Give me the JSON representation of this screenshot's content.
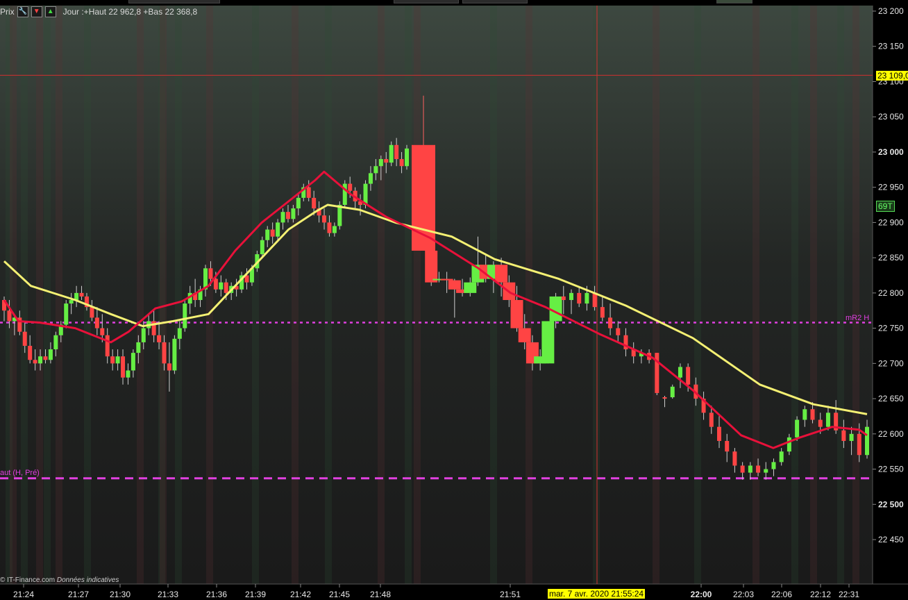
{
  "header": {
    "prefix_label": "Prix",
    "wrench_icon": "wrench-icon",
    "down_icon": "arrow-down-icon",
    "up_icon": "arrow-up-icon",
    "info": "Jour :+Haut 22 962,8 +Bas 22 368,8"
  },
  "credit": {
    "source": "© IT-Finance.com",
    "note": "Données indicatives"
  },
  "tags": {
    "cursor_price": "23 109,0",
    "count_badge": "69T",
    "cursor_datetime": "mar. 7 avr. 2020 21:55:24"
  },
  "levels": {
    "mr2_label": "mR2 H",
    "haut_label": "aut (H, Pré)"
  },
  "colors": {
    "bull": "#66ee44",
    "bear": "#ff4444",
    "ma_fast": "#e8113a",
    "ma_slow": "#f4f073",
    "level_line": "#e040e0",
    "cursor_line": "#d03030",
    "axis_text": "#e8e8e8",
    "tag_yellow": "#ffff00",
    "badge_green": "#55dd55"
  },
  "chart_data": {
    "type": "candlestick",
    "instrument_note": "Intraday tick candles",
    "yaxis": {
      "ticks": [
        23200,
        23150,
        23100,
        23050,
        23000,
        22950,
        22900,
        22850,
        22800,
        22750,
        22700,
        22650,
        22600,
        22550,
        22500,
        22450
      ],
      "tick_labels": [
        "23 200",
        "23 150",
        "23 100",
        "23 050",
        "23 000",
        "22 950",
        "22 900",
        "22 850",
        "22 800",
        "22 750",
        "22 700",
        "22 650",
        "22 600",
        "22 550",
        "22 500",
        "22 450"
      ],
      "bold_labels": [
        "23 000",
        "22 500"
      ],
      "range": [
        22440,
        23210
      ]
    },
    "xaxis": {
      "tick_labels": [
        "21:24",
        "21:27",
        "21:30",
        "21:33",
        "21:36",
        "21:39",
        "21:42",
        "21:45",
        "21:48",
        "21:51",
        "22:00",
        "22:03",
        "22:06",
        "22:12",
        "22:31"
      ],
      "bold_labels": [
        "22:00"
      ]
    },
    "reference_levels": [
      {
        "name": "mR2 H",
        "value": 22758,
        "style": "dotted"
      },
      {
        "name": "Haut (H, Pré)",
        "value": 22537,
        "style": "dashed"
      }
    ],
    "cursor": {
      "price": 23109.0,
      "datetime": "mar. 7 avr. 2020 21:55:24"
    },
    "series": [
      {
        "name": "candles",
        "ohlc": [
          [
            22790,
            22795,
            22760,
            22775
          ],
          [
            22775,
            22790,
            22750,
            22760
          ],
          [
            22760,
            22770,
            22740,
            22765
          ],
          [
            22765,
            22775,
            22740,
            22745
          ],
          [
            22745,
            22760,
            22715,
            22725
          ],
          [
            22725,
            22740,
            22700,
            22705
          ],
          [
            22705,
            22720,
            22690,
            22700
          ],
          [
            22700,
            22720,
            22690,
            22710
          ],
          [
            22710,
            22720,
            22700,
            22705
          ],
          [
            22705,
            22730,
            22700,
            22720
          ],
          [
            22720,
            22745,
            22710,
            22740
          ],
          [
            22740,
            22760,
            22730,
            22755
          ],
          [
            22755,
            22790,
            22750,
            22785
          ],
          [
            22785,
            22800,
            22770,
            22790
          ],
          [
            22790,
            22810,
            22780,
            22800
          ],
          [
            22800,
            22810,
            22790,
            22795
          ],
          [
            22795,
            22800,
            22775,
            22780
          ],
          [
            22780,
            22790,
            22760,
            22765
          ],
          [
            22765,
            22780,
            22740,
            22750
          ],
          [
            22750,
            22770,
            22730,
            22740
          ],
          [
            22740,
            22750,
            22700,
            22710
          ],
          [
            22710,
            22720,
            22690,
            22700
          ],
          [
            22700,
            22720,
            22690,
            22710
          ],
          [
            22710,
            22720,
            22670,
            22680
          ],
          [
            22680,
            22700,
            22670,
            22690
          ],
          [
            22690,
            22720,
            22680,
            22715
          ],
          [
            22715,
            22740,
            22700,
            22730
          ],
          [
            22730,
            22760,
            22720,
            22750
          ],
          [
            22750,
            22770,
            22740,
            22760
          ],
          [
            22760,
            22775,
            22730,
            22740
          ],
          [
            22740,
            22760,
            22720,
            22730
          ],
          [
            22730,
            22740,
            22690,
            22700
          ],
          [
            22700,
            22730,
            22660,
            22690
          ],
          [
            22690,
            22740,
            22685,
            22735
          ],
          [
            22735,
            22760,
            22720,
            22750
          ],
          [
            22750,
            22790,
            22745,
            22785
          ],
          [
            22785,
            22810,
            22770,
            22800
          ],
          [
            22800,
            22820,
            22780,
            22790
          ],
          [
            22790,
            22810,
            22780,
            22805
          ],
          [
            22805,
            22840,
            22795,
            22835
          ],
          [
            22835,
            22845,
            22810,
            22820
          ],
          [
            22820,
            22830,
            22800,
            22805
          ],
          [
            22805,
            22825,
            22795,
            22815
          ],
          [
            22815,
            22820,
            22790,
            22800
          ],
          [
            22800,
            22815,
            22790,
            22810
          ],
          [
            22810,
            22820,
            22795,
            22805
          ],
          [
            22805,
            22830,
            22800,
            22825
          ],
          [
            22825,
            22835,
            22805,
            22815
          ],
          [
            22815,
            22840,
            22810,
            22835
          ],
          [
            22835,
            22860,
            22830,
            22855
          ],
          [
            22855,
            22880,
            22850,
            22875
          ],
          [
            22875,
            22895,
            22865,
            22890
          ],
          [
            22890,
            22900,
            22870,
            22880
          ],
          [
            22880,
            22905,
            22875,
            22900
          ],
          [
            22900,
            22920,
            22890,
            22915
          ],
          [
            22915,
            22925,
            22900,
            22905
          ],
          [
            22905,
            22925,
            22900,
            22920
          ],
          [
            22920,
            22940,
            22910,
            22935
          ],
          [
            22935,
            22955,
            22930,
            22950
          ],
          [
            22950,
            22960,
            22930,
            22935
          ],
          [
            22935,
            22945,
            22910,
            22920
          ],
          [
            22920,
            22930,
            22900,
            22910
          ],
          [
            22910,
            22920,
            22890,
            22900
          ],
          [
            22900,
            22910,
            22880,
            22885
          ],
          [
            22885,
            22900,
            22880,
            22895
          ],
          [
            22895,
            22930,
            22890,
            22925
          ],
          [
            22925,
            22960,
            22920,
            22955
          ],
          [
            22955,
            22965,
            22935,
            22945
          ],
          [
            22945,
            22950,
            22920,
            22930
          ],
          [
            22930,
            22940,
            22910,
            22925
          ],
          [
            22925,
            22960,
            22920,
            22955
          ],
          [
            22955,
            22980,
            22945,
            22970
          ],
          [
            22970,
            22990,
            22960,
            22980
          ],
          [
            22980,
            22995,
            22960,
            22990
          ],
          [
            22990,
            23000,
            22970,
            22985
          ],
          [
            22985,
            23015,
            22980,
            23010
          ],
          [
            23010,
            23020,
            22980,
            22990
          ],
          [
            22990,
            23000,
            22970,
            22980
          ],
          [
            22980,
            23010,
            22975,
            23005
          ],
          [
            23010,
            23080,
            22860,
            22860
          ],
          [
            22860,
            22860,
            22810,
            22815
          ],
          [
            22820,
            22830,
            22815,
            22820
          ],
          [
            22820,
            22830,
            22800,
            22818
          ],
          [
            22818,
            22820,
            22765,
            22805
          ],
          [
            22805,
            22820,
            22795,
            22800
          ],
          [
            22800,
            22822,
            22795,
            22815
          ],
          [
            22815,
            22880,
            22810,
            22840
          ],
          [
            22840,
            22855,
            22815,
            22820
          ],
          [
            22820,
            22845,
            22800,
            22840
          ],
          [
            22840,
            22850,
            22795,
            22815
          ],
          [
            22815,
            22825,
            22780,
            22790
          ],
          [
            22790,
            22810,
            22745,
            22750
          ],
          [
            22750,
            22770,
            22720,
            22730
          ],
          [
            22730,
            22740,
            22690,
            22700
          ],
          [
            22700,
            22720,
            22690,
            22710
          ],
          [
            22700,
            22760,
            22700,
            22760
          ],
          [
            22760,
            22800,
            22750,
            22795
          ],
          [
            22795,
            22810,
            22770,
            22790
          ],
          [
            22790,
            22805,
            22770,
            22800
          ],
          [
            22800,
            22810,
            22780,
            22785
          ],
          [
            22785,
            22810,
            22775,
            22800
          ],
          [
            22800,
            22810,
            22775,
            22780
          ],
          [
            22780,
            22795,
            22760,
            22765
          ],
          [
            22765,
            22785,
            22740,
            22750
          ],
          [
            22750,
            22760,
            22730,
            22740
          ],
          [
            22740,
            22750,
            22710,
            22720
          ],
          [
            22720,
            22730,
            22700,
            22710
          ],
          [
            22710,
            22720,
            22700,
            22715
          ],
          [
            22715,
            22720,
            22700,
            22705
          ],
          [
            22715,
            22715,
            22655,
            22658
          ],
          [
            22652,
            22654,
            22638,
            22650
          ],
          [
            22652,
            22670,
            22650,
            22667
          ],
          [
            22680,
            22700,
            22665,
            22695
          ],
          [
            22695,
            22700,
            22660,
            22670
          ],
          [
            22670,
            22680,
            22640,
            22650
          ],
          [
            22650,
            22660,
            22620,
            22630
          ],
          [
            22630,
            22640,
            22600,
            22610
          ],
          [
            22610,
            22625,
            22580,
            22590
          ],
          [
            22590,
            22600,
            22560,
            22575
          ],
          [
            22575,
            22580,
            22545,
            22555
          ],
          [
            22555,
            22560,
            22535,
            22545
          ],
          [
            22545,
            22560,
            22535,
            22555
          ],
          [
            22555,
            22565,
            22540,
            22545
          ],
          [
            22545,
            22560,
            22535,
            22550
          ],
          [
            22550,
            22565,
            22540,
            22560
          ],
          [
            22560,
            22580,
            22555,
            22575
          ],
          [
            22575,
            22600,
            22570,
            22595
          ],
          [
            22595,
            22625,
            22590,
            22620
          ],
          [
            22620,
            22640,
            22610,
            22635
          ],
          [
            22635,
            22645,
            22615,
            22620
          ],
          [
            22620,
            22630,
            22600,
            22610
          ],
          [
            22610,
            22640,
            22605,
            22630
          ],
          [
            22630,
            22648,
            22600,
            22605
          ],
          [
            22605,
            22620,
            22580,
            22590
          ],
          [
            22590,
            22610,
            22570,
            22600
          ],
          [
            22600,
            22615,
            22560,
            22570
          ],
          [
            22570,
            22620,
            22565,
            22610
          ]
        ]
      },
      {
        "name": "ma_fast",
        "values": [
          [
            0,
            22790
          ],
          [
            8,
            22760
          ],
          [
            20,
            22758
          ],
          [
            40,
            22750
          ],
          [
            60,
            22730
          ],
          [
            70,
            22745
          ],
          [
            85,
            22778
          ],
          [
            100,
            22788
          ],
          [
            115,
            22810
          ],
          [
            130,
            22860
          ],
          [
            145,
            22900
          ],
          [
            160,
            22930
          ],
          [
            175,
            22960
          ],
          [
            180,
            22972
          ],
          [
            195,
            22940
          ],
          [
            215,
            22908
          ],
          [
            232,
            22878
          ],
          [
            250,
            22835
          ],
          [
            262,
            22800
          ],
          [
            275,
            22780
          ],
          [
            295,
            22742
          ],
          [
            315,
            22708
          ],
          [
            330,
            22662
          ],
          [
            348,
            22598
          ],
          [
            360,
            22580
          ],
          [
            370,
            22595
          ],
          [
            382,
            22610
          ],
          [
            392,
            22606
          ],
          [
            395,
            22598
          ]
        ]
      },
      {
        "name": "ma_slow",
        "values": [
          [
            0,
            22845
          ],
          [
            15,
            22810
          ],
          [
            40,
            22790
          ],
          [
            60,
            22770
          ],
          [
            78,
            22753
          ],
          [
            95,
            22760
          ],
          [
            115,
            22770
          ],
          [
            130,
            22810
          ],
          [
            145,
            22850
          ],
          [
            160,
            22890
          ],
          [
            175,
            22915
          ],
          [
            182,
            22925
          ],
          [
            200,
            22918
          ],
          [
            220,
            22900
          ],
          [
            240,
            22880
          ],
          [
            256,
            22848
          ],
          [
            280,
            22820
          ],
          [
            305,
            22782
          ],
          [
            330,
            22736
          ],
          [
            355,
            22670
          ],
          [
            375,
            22642
          ],
          [
            395,
            22628
          ]
        ]
      }
    ]
  }
}
